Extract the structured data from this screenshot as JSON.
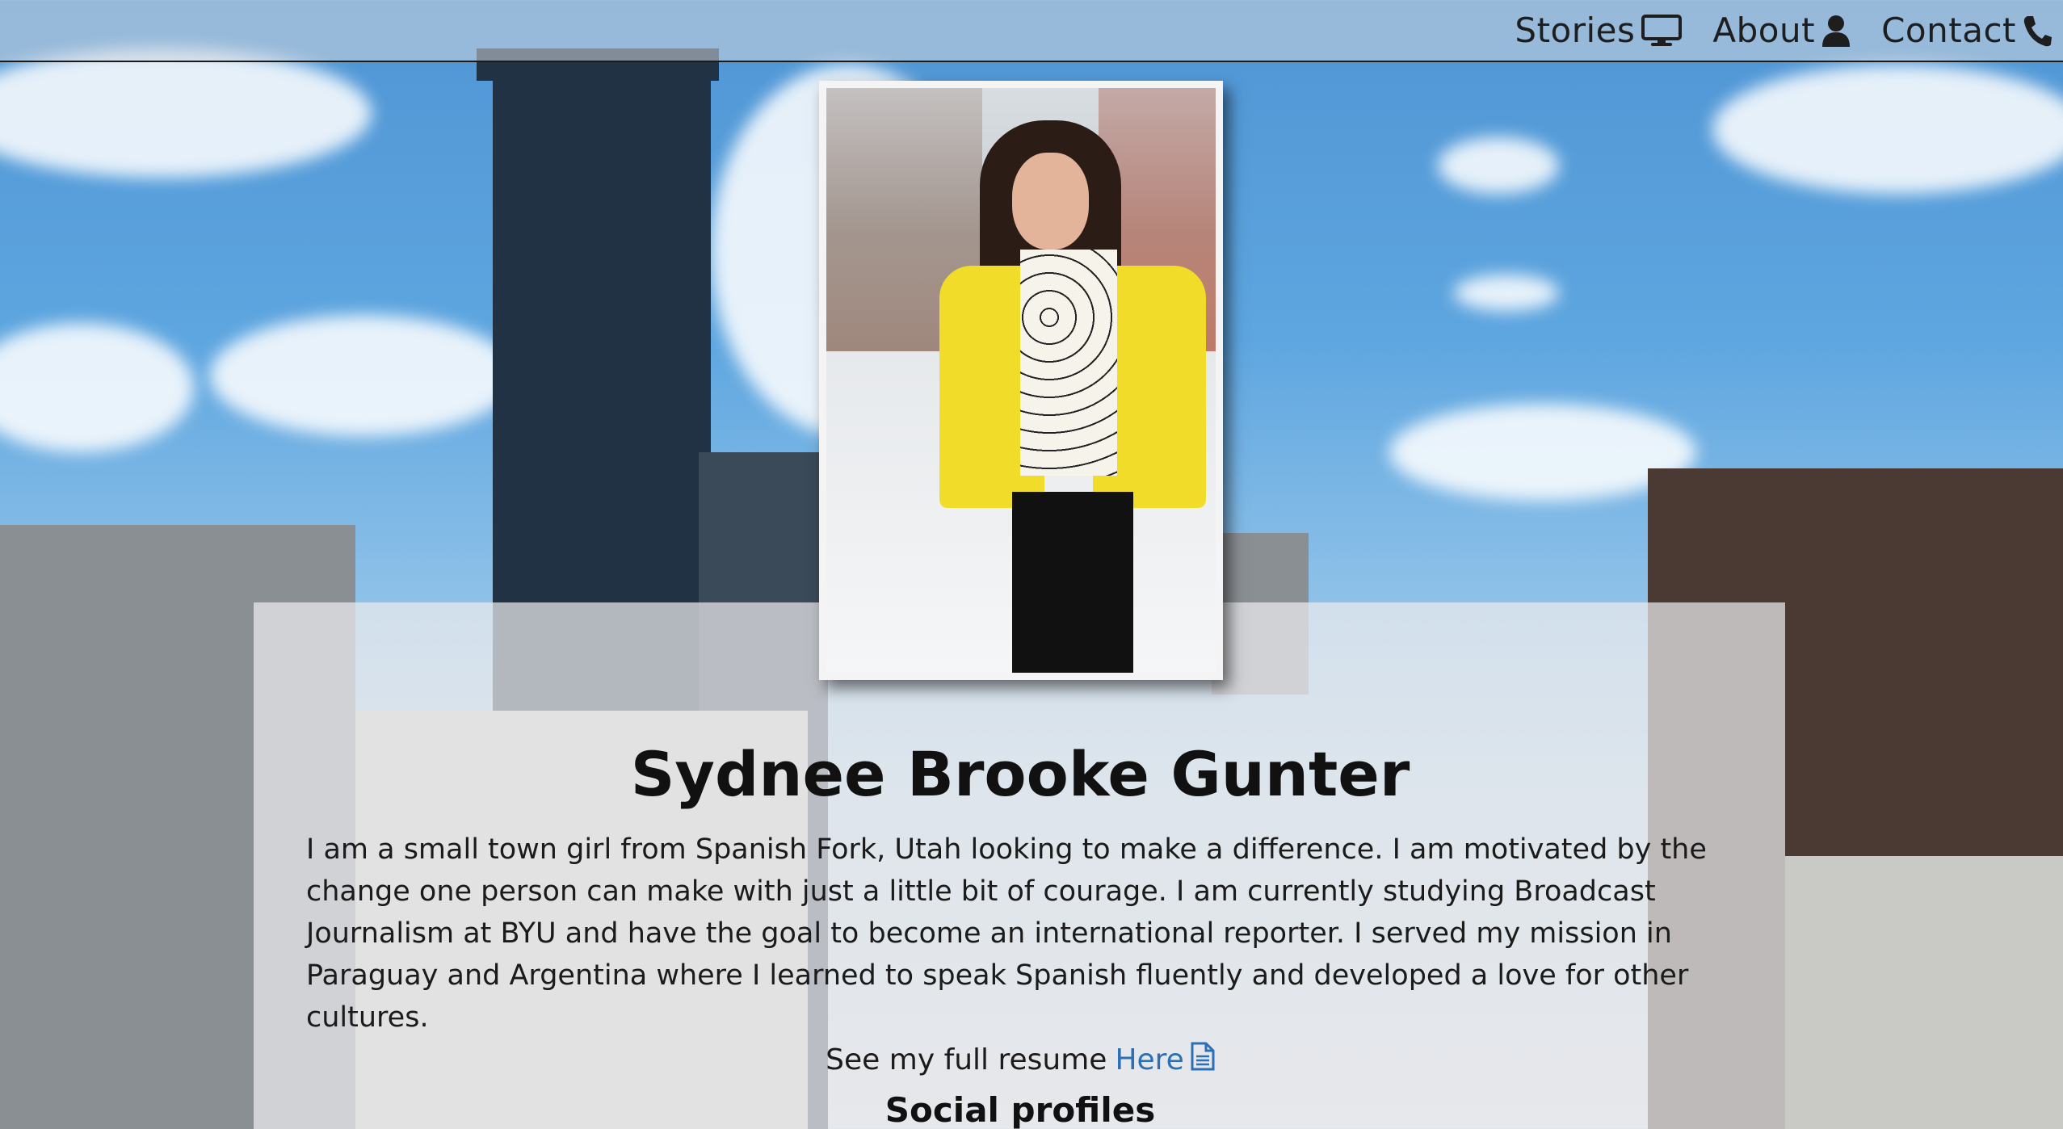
{
  "nav": {
    "items": [
      {
        "label": "Stories",
        "icon": "monitor-icon"
      },
      {
        "label": "About",
        "icon": "user-icon"
      },
      {
        "label": "Contact",
        "icon": "phone-icon"
      }
    ]
  },
  "profile": {
    "name": "Sydnee Brooke Gunter",
    "bio": "I am a small town girl from Spanish Fork, Utah looking to make a difference. I am motivated by the change one person can make with just a little bit of courage. I am currently studying Broadcast Journalism at BYU and have the goal to become an international reporter. I served my mission in Paraguay and Argentina where I learned to speak Spanish fluently and developed a love for other cultures.",
    "resume_prefix": "See my full resume",
    "resume_link": "Here",
    "resume_icon": "file-text-icon",
    "social_heading": "Social profiles"
  },
  "colors": {
    "link": "#2d6fb5",
    "text": "#1b1b1b",
    "nav_border": "#1a1a1a"
  }
}
